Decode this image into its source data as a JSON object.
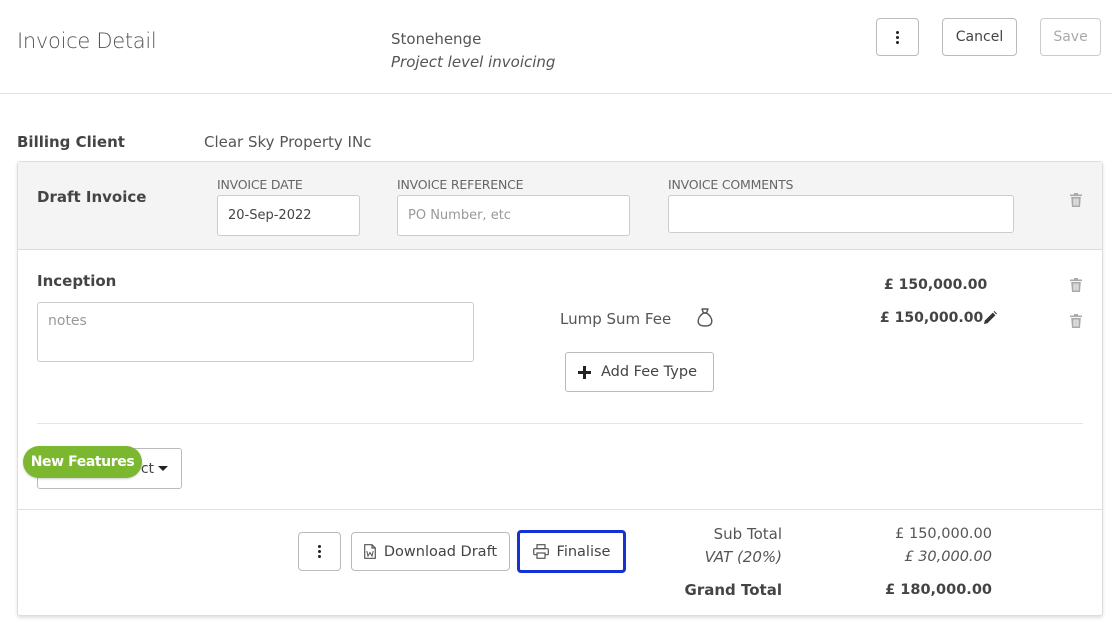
{
  "header": {
    "title": "Invoice Detail",
    "project_name": "Stonehenge",
    "project_subtitle": "Project level invoicing",
    "cancel_label": "Cancel",
    "save_label": "Save"
  },
  "billing": {
    "label": "Billing Client",
    "value": "Clear Sky Property INc"
  },
  "draft": {
    "title": "Draft Invoice",
    "invoice_date_label": "INVOICE DATE",
    "invoice_date_value": "20-Sep-2022",
    "invoice_reference_label": "INVOICE REFERENCE",
    "invoice_reference_placeholder": "PO Number, etc",
    "invoice_comments_label": "INVOICE COMMENTS",
    "invoice_comments_value": ""
  },
  "stage": {
    "title": "Inception",
    "notes_placeholder": "notes",
    "stage_total": "£ 150,000.00",
    "fee_name": "Lump Sum Fee",
    "fee_amount": "£ 150,000.00",
    "add_fee_label": "Add Fee Type"
  },
  "select": {
    "partial_label": "ct"
  },
  "badge": {
    "new_features": "New Features"
  },
  "footer": {
    "download_label": "Download Draft",
    "finalise_label": "Finalise",
    "sub_total_label": "Sub Total",
    "sub_total_value": "£ 150,000.00",
    "vat_label": "VAT (20%)",
    "vat_value": "£ 30,000.00",
    "grand_total_label": "Grand Total",
    "grand_total_value": "£ 180,000.00"
  },
  "colors": {
    "accent_green": "#7cb82f",
    "focus_blue": "#1432d4"
  }
}
